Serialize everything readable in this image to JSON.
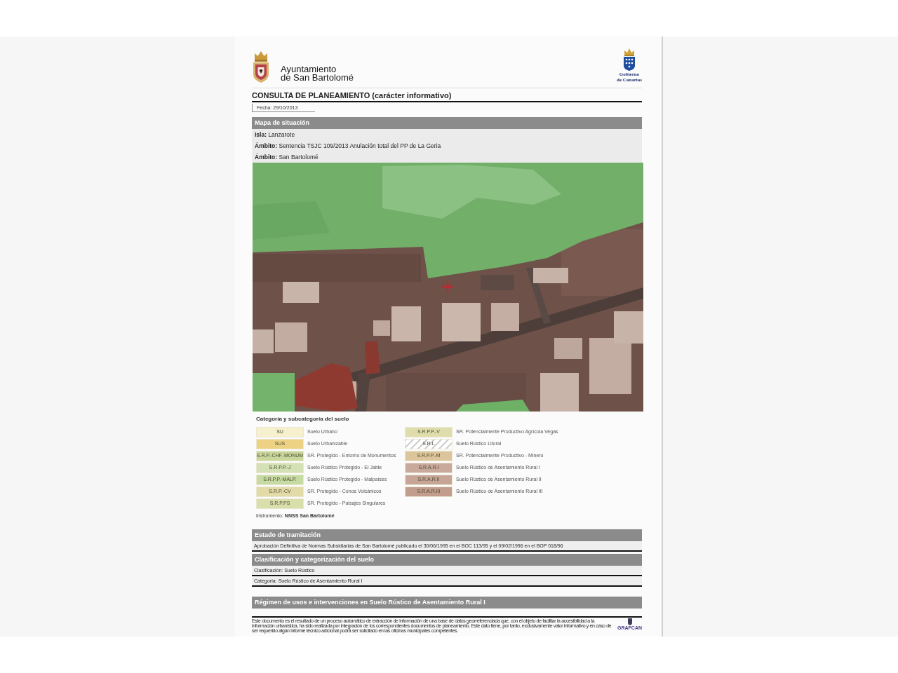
{
  "header": {
    "municipality_lines": [
      "Ayuntamiento",
      "de San Bartolomé"
    ],
    "government_lines": [
      "Gobierno",
      "de Canarias"
    ]
  },
  "title": "CONSULTA DE PLANEAMIENTO (carácter informativo)",
  "date": "Fecha: 29/10/2013",
  "location": {
    "heading": "Mapa de situación",
    "rows": [
      "**Isla:** Lanzarote",
      "**Ámbito:** Sentencia TSJC 109/2013 Anulación total del PP de La Geria",
      "**Ámbito:** San Bartolomé"
    ],
    "legend": {
      "title": "Categoría y subcategoría del suelo",
      "columns": [
        {
          "items": [
            {
              "code": "SU",
              "label": "Suelo Urbano",
              "color": "#f7f0cf",
              "kind": "solid"
            },
            {
              "code": "SUS",
              "label": "Suelo Urbanizable",
              "color": "#eed283",
              "kind": "solid"
            },
            {
              "code": "S.R.P.-CHF. MONUM",
              "label": "SR. Protegido - Entorno de Monumentos",
              "color": "#c9d79c",
              "kind": "solid"
            },
            {
              "code": "S.R.P.P.-J",
              "label": "Suelo Rústico Protegido - El Jable",
              "color": "#d3e1b4",
              "kind": "solid"
            },
            {
              "code": "S.R.P.P.-MALP.",
              "label": "Suelo Rústico Protegido - Malpaíses",
              "color": "#c6dba1",
              "kind": "solid"
            },
            {
              "code": "S.R.P.-CV",
              "label": "SR. Protegido - Conos Volcánicos",
              "color": "#e3dba7",
              "kind": "solid"
            },
            {
              "code": "S.R.P.PS",
              "label": "SR. Protegido - Paisajes Singulares",
              "color": "#d9dfab",
              "kind": "solid"
            }
          ]
        },
        {
          "items": [
            {
              "code": "S.R.P.P.-V",
              "label": "SR. Potencialmente Productivo Agrícola Vegas",
              "color": "#e0ddac",
              "kind": "solid"
            },
            {
              "code": "S.R.L",
              "label": "Suelo Rústico Litoral",
              "color": "#cfcfcf",
              "kind": "hatched"
            },
            {
              "code": "S.R.P.P.-M",
              "label": "SR. Potencialmente Productivo - Minero",
              "color": "#dcc59b",
              "kind": "solid"
            },
            {
              "code": "S.R.A.R.I",
              "label": "Suelo Rústico de Asentamiento Rural I",
              "color": "#c9a99c",
              "kind": "solid"
            },
            {
              "code": "S.R.A.R.II",
              "label": "Suelo Rústico de Asentamiento Rural II",
              "color": "#c6a597",
              "kind": "solid"
            },
            {
              "code": "S.R.A.R.III",
              "label": "Suelo Rústico de Asentamiento Rural III",
              "color": "#c29d8d",
              "kind": "solid"
            }
          ]
        }
      ],
      "instrument": "Instrumento: **NNSS San Bartolomé**"
    }
  },
  "processing": {
    "heading": "Estado de tramitación",
    "rows": [
      "Aprobación Definitiva de Normas Subsidiarias de San Bartolomé publicado el 30/06/1995 en el BOC 113/95 y el 09/02/1996 en el BOP 018/96"
    ]
  },
  "classification": {
    "heading": "Clasificación y categorización del suelo",
    "rows": [
      "Clasificación: Suelo Rústico",
      "Categoría: Suelo Rústico de Asentamiento Rural I"
    ]
  },
  "regime": {
    "heading": "Régimen de usos e intervenciones en Suelo Rústico de Asentamiento Rural I"
  },
  "footer": {
    "disclaimer": "Este documento es el resultado de un proceso automático de extracción de información de una base de datos georreferenciada que, con el objeto de facilitar la accesibilidad a la información urbanística, ha sido realizada por integración de los correspondientes documentos de planeamiento. Este dato tiene, por tanto, exclusivamente valor informativo y en caso de ser requerido algún informe técnico adicional podrá ser solicitado en las oficinas municipales competentes.",
    "logo_text": "GRAFCAN"
  }
}
